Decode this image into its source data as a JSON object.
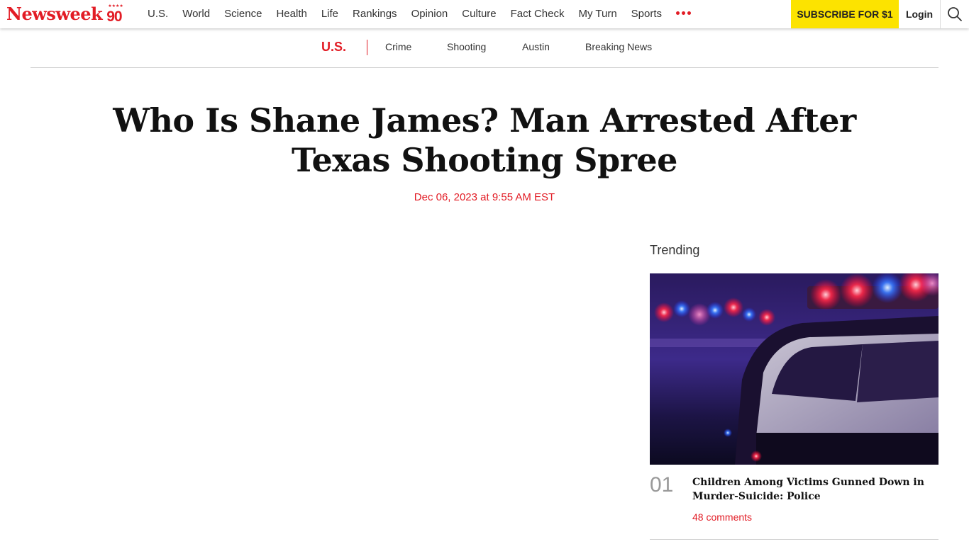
{
  "header": {
    "logo_text": "Newsweek",
    "logo_badge": "90",
    "nav": [
      "U.S.",
      "World",
      "Science",
      "Health",
      "Life",
      "Rankings",
      "Opinion",
      "Culture",
      "Fact Check",
      "My Turn",
      "Sports"
    ],
    "more_icon": "more-dots-icon",
    "subscribe_label": "SUBSCRIBE FOR $1",
    "login_label": "Login",
    "search_icon": "search-icon"
  },
  "subnav": {
    "section": "U.S.",
    "links": [
      "Crime",
      "Shooting",
      "Austin",
      "Breaking News"
    ]
  },
  "article": {
    "title": "Who Is Shane James? Man Arrested After Texas Shooting Spree",
    "date": "Dec 06, 2023 at 9:55 AM EST"
  },
  "trending": {
    "title": "Trending",
    "items": [
      {
        "rank": "01",
        "headline": "Children Among Victims Gunned Down in Murder-Suicide: Police",
        "comments": "48 comments"
      }
    ]
  },
  "colors": {
    "brand_red": "#e21c25",
    "subscribe_yellow": "#fce300"
  }
}
